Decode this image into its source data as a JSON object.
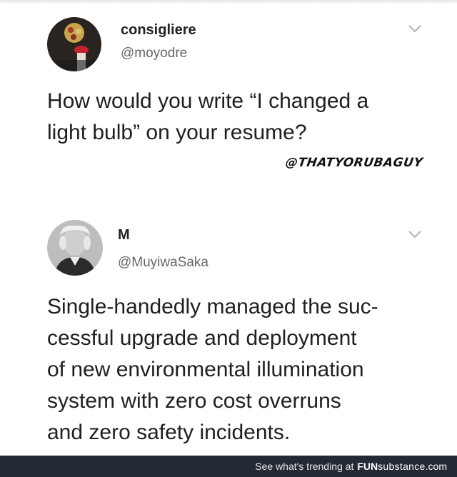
{
  "tweets": [
    {
      "display_name": "consigliere",
      "handle": "@moyodre",
      "text_lines": [
        "How would you write “I changed a",
        "light bulb” on your resume?"
      ],
      "watermark": "@THATYORUBAGUY",
      "icon": "chevron-down-icon"
    },
    {
      "display_name": "M",
      "handle": "@MuyiwaSaka",
      "text_lines": [
        "Single-handedly managed the suc-",
        "cessful upgrade and deployment",
        "of new environmental illumination",
        "system with zero cost overruns",
        "and zero safety incidents."
      ],
      "icon": "chevron-down-icon"
    }
  ],
  "footer": {
    "trending_text": "See what's trending at",
    "brand_fun": "FUN",
    "brand_sub": "substance",
    "brand_com": ".com"
  },
  "colors": {
    "footer_bg": "#232a33",
    "handle": "#666666",
    "chevron": "#b3b3b3"
  }
}
